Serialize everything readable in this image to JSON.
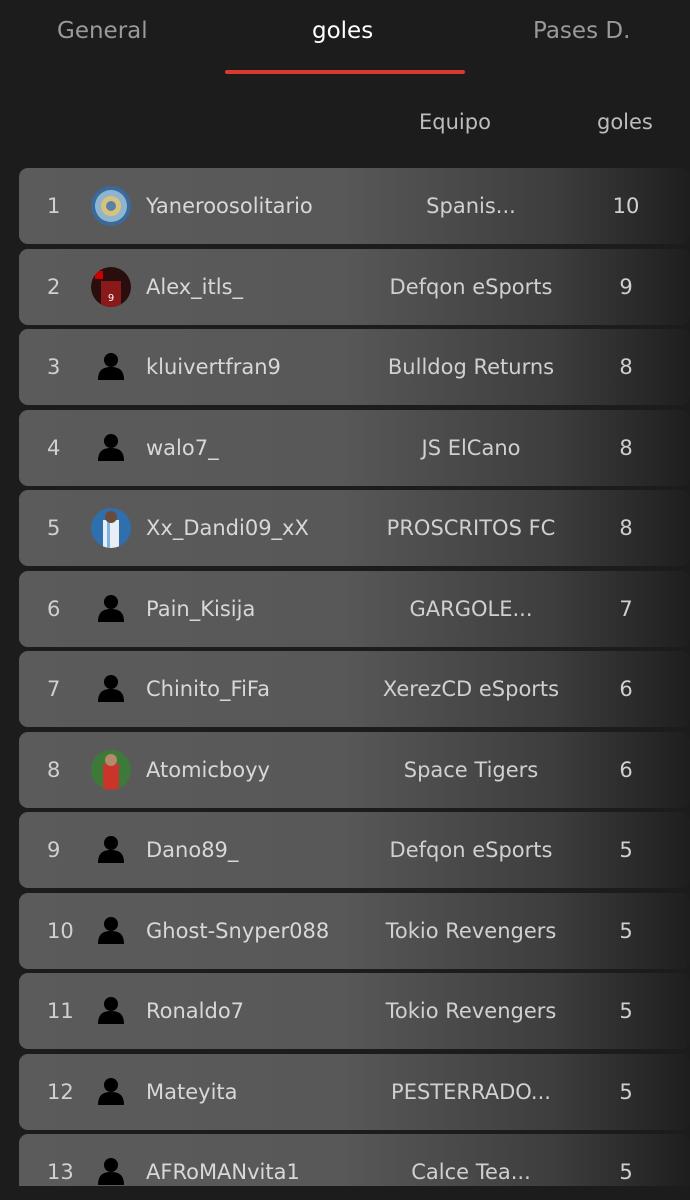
{
  "tabs": [
    {
      "label": "General",
      "selected": false
    },
    {
      "label": "goles",
      "selected": true
    },
    {
      "label": "Pases D.",
      "selected": false
    }
  ],
  "accent_color": "#d63a2f",
  "columns": {
    "equipo": "Equipo",
    "goles": "goles"
  },
  "rows": [
    {
      "rank": "1",
      "name": "Yaneroosolitario",
      "team": "Spanis...",
      "goals": "10",
      "avatar": "photo-blue"
    },
    {
      "rank": "2",
      "name": "Alex_itls_",
      "team": "Defqon eSports",
      "goals": "9",
      "avatar": "photo-red"
    },
    {
      "rank": "3",
      "name": "kluivertfran9",
      "team": "Bulldog Returns",
      "goals": "8",
      "avatar": "person-icon"
    },
    {
      "rank": "4",
      "name": "walo7_",
      "team": "JS ElCano",
      "goals": "8",
      "avatar": "person-icon"
    },
    {
      "rank": "5",
      "name": "Xx_Dandi09_xX",
      "team": "PROSCRITOS FC",
      "goals": "8",
      "avatar": "photo-lightblue"
    },
    {
      "rank": "6",
      "name": "Pain_Kisija",
      "team": "GARGOLE...",
      "goals": "7",
      "avatar": "person-icon"
    },
    {
      "rank": "7",
      "name": "Chinito_FiFa",
      "team": "XerezCD eSports",
      "goals": "6",
      "avatar": "person-icon"
    },
    {
      "rank": "8",
      "name": "Atomicboyy",
      "team": "Space Tigers",
      "goals": "6",
      "avatar": "photo-green"
    },
    {
      "rank": "9",
      "name": "Dano89_",
      "team": "Defqon eSports",
      "goals": "5",
      "avatar": "person-icon"
    },
    {
      "rank": "10",
      "name": "Ghost-Snyper088",
      "team": "Tokio Revengers",
      "goals": "5",
      "avatar": "person-icon"
    },
    {
      "rank": "11",
      "name": "Ronaldo7",
      "team": "Tokio Revengers",
      "goals": "5",
      "avatar": "person-icon"
    },
    {
      "rank": "12",
      "name": "Mateyita",
      "team": "PESTERRADO...",
      "goals": "5",
      "avatar": "person-icon"
    },
    {
      "rank": "13",
      "name": "AFRoMANvita1",
      "team": "Calce Tea...",
      "goals": "5",
      "avatar": "person-icon"
    }
  ]
}
